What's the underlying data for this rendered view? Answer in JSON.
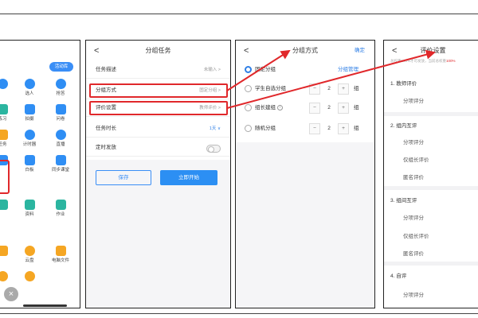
{
  "colors": {
    "accent": "#2f7fe6",
    "highlight": "#e0282b",
    "primary_button": "#2c8ff3"
  },
  "panel1": {
    "top_button": "活动库",
    "apps": [
      {
        "label": "",
        "icon": "mic-icon"
      },
      {
        "label": "选人",
        "icon": "person-icon"
      },
      {
        "label": "抢答",
        "icon": "microphone-icon"
      },
      {
        "label": "练习",
        "icon": "practice-icon"
      },
      {
        "label": "拍摄",
        "icon": "camera-icon"
      },
      {
        "label": "问卷",
        "icon": "questionnaire-icon"
      },
      {
        "label": "任务",
        "icon": "task-icon"
      },
      {
        "label": "计时器",
        "icon": "timer-icon"
      },
      {
        "label": "直播",
        "icon": "live-icon"
      },
      {
        "label": "",
        "icon": "file-icon"
      },
      {
        "label": "白板",
        "icon": "whiteboard-icon"
      },
      {
        "label": "同步课堂",
        "icon": "sync-class-icon"
      },
      {
        "label": "",
        "icon": "doc-icon"
      },
      {
        "label": "资料",
        "icon": "folder-icon"
      },
      {
        "label": "作业",
        "icon": "homework-icon"
      },
      {
        "label": "",
        "icon": "grid-icon"
      },
      {
        "label": "云盘",
        "icon": "cloud-icon"
      },
      {
        "label": "电脑文件",
        "icon": "monitor-icon"
      },
      {
        "label": "",
        "icon": "circle-icon"
      },
      {
        "label": "",
        "icon": "search-icon"
      }
    ],
    "close_symbol": "×"
  },
  "panel2": {
    "title": "分组任务",
    "back": "<",
    "rows": [
      {
        "label": "任务描述",
        "value": "未输入 >"
      },
      {
        "label": "分组方式",
        "value": "固定分组 >"
      },
      {
        "label": "评价设置",
        "value": "教师评价 >"
      },
      {
        "label": "任务时长",
        "value": "1天 ∨"
      },
      {
        "label": "定时发放",
        "value": ""
      }
    ],
    "save": "保存",
    "start": "立即开始"
  },
  "panel3": {
    "title": "分组方式",
    "back": "<",
    "confirm": "确定",
    "options": [
      {
        "label": "固定分组",
        "tag": "分组管理",
        "selected": true
      },
      {
        "label": "学生自选分组",
        "count": "2",
        "unit": "组",
        "selected": false
      },
      {
        "label": "组长建组",
        "count": "2",
        "unit": "组",
        "selected": false,
        "info": "i"
      },
      {
        "label": "随机分组",
        "count": "2",
        "unit": "组",
        "selected": false
      }
    ],
    "minus": "−",
    "plus": "+"
  },
  "panel4": {
    "title": "评价设置",
    "back": "<",
    "note_prefix": "总权重100%才可发放，当前总权重",
    "note_value": "100%",
    "sections": [
      {
        "title": "1. 教师评价",
        "items": [
          "分项评分"
        ]
      },
      {
        "title": "2. 组内互评",
        "items": [
          "分项评分",
          "仅组长评价",
          "匿名评价"
        ]
      },
      {
        "title": "3. 组间互评",
        "items": [
          "分项评分",
          "仅组长评价",
          "匿名评价"
        ]
      },
      {
        "title": "4. 自评",
        "items": [
          "分项评分"
        ]
      }
    ]
  }
}
